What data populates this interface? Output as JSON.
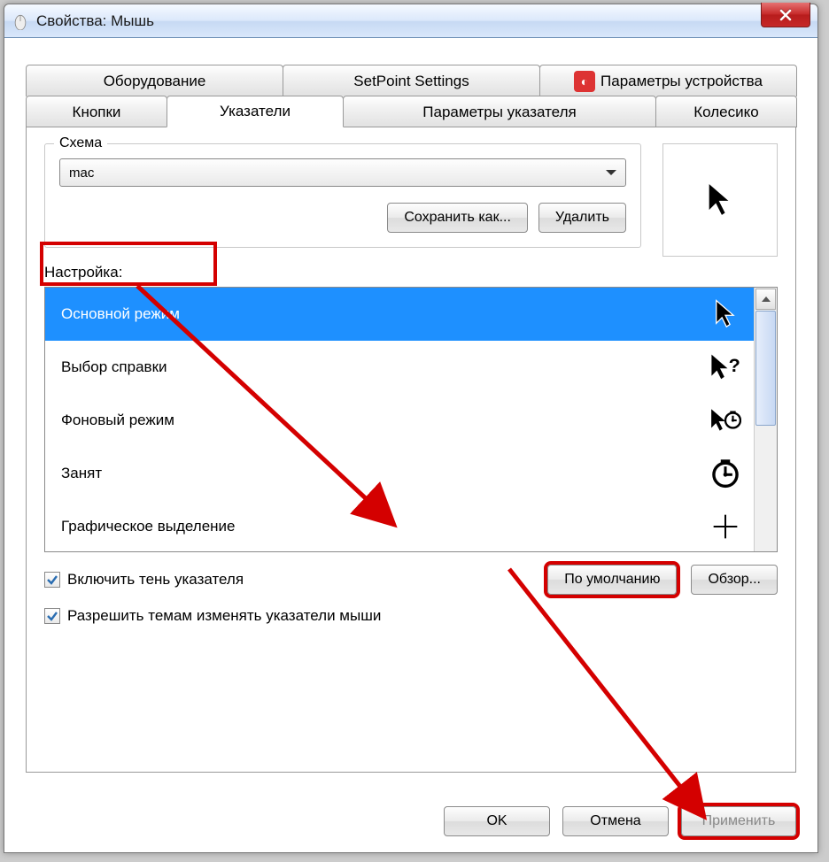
{
  "window": {
    "title": "Свойства: Мышь"
  },
  "tabs_top": [
    "Оборудование",
    "SetPoint Settings",
    "Параметры устройства"
  ],
  "tabs_bottom": [
    "Кнопки",
    "Указатели",
    "Параметры указателя",
    "Колесико"
  ],
  "schema": {
    "legend": "Схема",
    "selected": "mac",
    "save_as": "Сохранить как...",
    "delete": "Удалить"
  },
  "settings_label": "Настройка:",
  "list": [
    {
      "label": "Основной режим",
      "icon": "arrow"
    },
    {
      "label": "Выбор справки",
      "icon": "arrow-help"
    },
    {
      "label": "Фоновый режим",
      "icon": "arrow-wait"
    },
    {
      "label": "Занят",
      "icon": "wait"
    },
    {
      "label": "Графическое выделение",
      "icon": "cross"
    }
  ],
  "opts": {
    "shadow": "Включить тень указателя",
    "allow_themes": "Разрешить темам изменять указатели мыши",
    "default": "По умолчанию",
    "browse": "Обзор..."
  },
  "buttons": {
    "ok": "OK",
    "cancel": "Отмена",
    "apply": "Применить"
  }
}
